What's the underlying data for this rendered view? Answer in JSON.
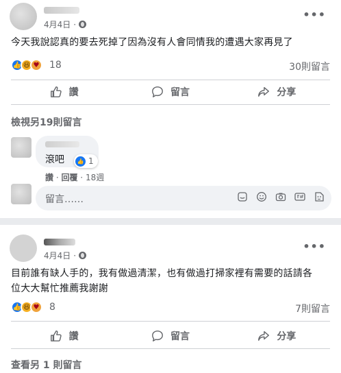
{
  "post1": {
    "date": "4月4日",
    "text": "今天我說認真的要去死掉了因為沒有人會同情我的遭遇大家再見了",
    "reaction_count": "18",
    "comment_count": "30則留言",
    "actions": {
      "like": "讚",
      "comment": "留言",
      "share": "分享"
    },
    "view_more": "檢視另19則留言",
    "comment": {
      "text": "滾吧",
      "likes": "1",
      "like_link": "讚",
      "reply_link": "回覆",
      "time": "18週"
    },
    "write_placeholder": "留言……"
  },
  "post2": {
    "date": "4月4日",
    "text_line1": "目前誰有缺人手的，我有做過清潔，也有做過打掃家裡有需要的話請各",
    "text_line2": "位大大幫忙推薦我謝謝",
    "reaction_count": "8",
    "comment_count": "7則留言",
    "actions": {
      "like": "讚",
      "comment": "留言",
      "share": "分享"
    },
    "view_more": "查看另 1 則留言"
  },
  "icons": [
    "globe-icon",
    "more-icon",
    "like-icon",
    "comment-icon",
    "share-icon",
    "sticker-icon",
    "emoji-icon",
    "camera-icon",
    "gif-icon",
    "avatar-sticker-icon"
  ],
  "colors": {
    "like_blue": "#1877f2",
    "text": "#1c1e21",
    "secondary": "#65676b",
    "bubble": "#f0f2f5"
  }
}
